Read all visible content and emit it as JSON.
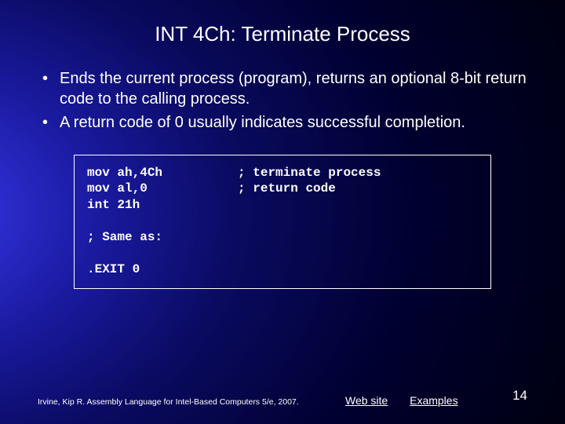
{
  "title": "INT 4Ch: Terminate Process",
  "bullets": [
    "Ends the current process (program), returns an optional 8-bit return code to the calling process.",
    "A return code of 0 usually indicates successful completion."
  ],
  "code": "mov ah,4Ch          ; terminate process\nmov al,0            ; return code\nint 21h\n\n; Same as:\n\n.EXIT 0",
  "footer": {
    "citation": "Irvine, Kip R. Assembly Language for Intel-Based Computers 5/e, 2007.",
    "link1": "Web site",
    "link2": "Examples",
    "page": "14"
  }
}
